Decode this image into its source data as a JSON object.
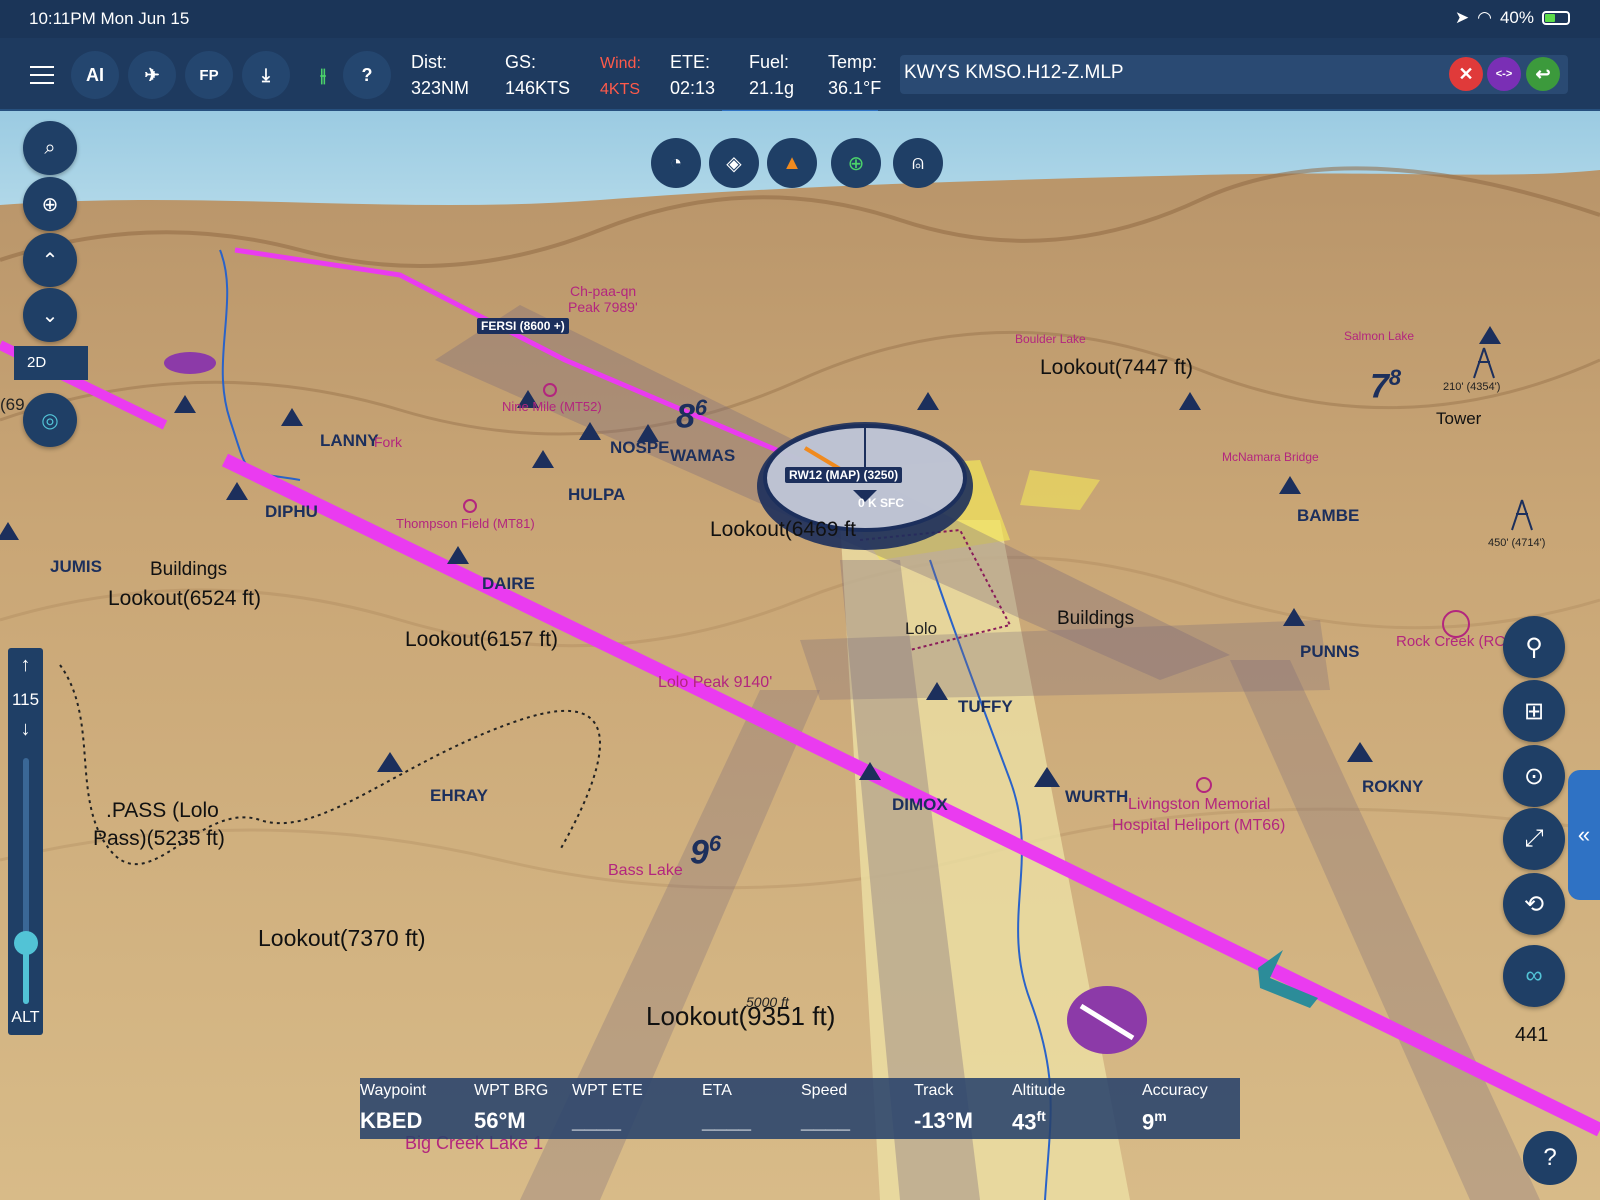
{
  "status": {
    "time": "10:11PM  Mon Jun 15",
    "battery": "40%",
    "battery_fill": 0.4
  },
  "toolbar": {
    "ai_label": "AI",
    "fp_label": "FP",
    "dist_label": "Dist:",
    "dist_value": "323NM",
    "gs_label": "GS:",
    "gs_value": "146KTS",
    "wind_label": "Wind:",
    "wind_value": "4KTS",
    "ete_label": "ETE:",
    "ete_value": "02:13",
    "fuel_label": "Fuel:",
    "fuel_value": "21.1g",
    "temp_label": "Temp:",
    "temp_value": "36.1°F",
    "route": "KWYS KMSO.H12-Z.MLP",
    "swap_label": "<->"
  },
  "map": {
    "mode_label": "2D",
    "alt_value": "115",
    "alt_label": "ALT",
    "alt_level": 0.25,
    "count": "441",
    "labels": {
      "lookout_7447": "Lookout(7447 ft)",
      "lookout_6469": "Lookout(6469 ft",
      "lookout_6524": "Lookout(6524 ft)",
      "lookout_6157": "Lookout(6157 ft)",
      "lookout_7370": "Lookout(7370 ft)",
      "lookout_9351": "Lookout(9351 ft)",
      "lolo_pass_1": ".PASS (Lolo",
      "lolo_pass_2": "Pass)(5235 ft)",
      "buildings1": "Buildings",
      "buildings2": "Buildings",
      "tower": "Tower",
      "lanny": "LANNY",
      "nospe": "NOSPE",
      "wamas": "WAMAS",
      "hulpa": "HULPA",
      "diphu": "DIPHU",
      "jumis": "JUMIS",
      "daire": "DAIRE",
      "ehray": "EHRAY",
      "tuffy": "TUFFY",
      "wurth": "WURTH",
      "dimox": "DIMOX",
      "rokny": "ROKNY",
      "punns": "PUNNS",
      "bambe": "BAMBE",
      "lolo": "Lolo",
      "fork": "Fork",
      "chpaa1": "Ch-paa-qn",
      "chpaa2": "Peak 7989'",
      "ninemile": "Nine Mile (MT52)",
      "thompson": "Thompson Field (MT81)",
      "lolopeak": "Lolo Peak 9140'",
      "basslake": "Bass Lake",
      "boulder": "Boulder Lake",
      "salmon": "Salmon Lake",
      "mcnamara": "McNamara Bridge",
      "rockcreek": "Rock Creek (RC",
      "livingston1": "Livingston Memorial",
      "livingston2": "Hospital Heliport (MT66)",
      "bigcreek": "Big Creek Lake 1",
      "fersi": "FERSI (8600 +)",
      "rw12": "RW12 (MAP) (3250)",
      "sfc": "0 K SFC",
      "t210": "210' (4354')",
      "t450": "450' (4714')",
      "mef_86": "8",
      "mef_86_sup": "6",
      "mef_78": "7",
      "mef_78_sup": "8",
      "mef_96": "9",
      "mef_96_sup": "6",
      "contour5000": "5000 ft",
      "left69": "(69"
    }
  },
  "infobar": {
    "cols": [
      {
        "h": "Waypoint",
        "v": "KBED",
        "sup": ""
      },
      {
        "h": "WPT BRG",
        "v": "56°M",
        "sup": ""
      },
      {
        "h": "WPT ETE",
        "v": "____",
        "sup": ""
      },
      {
        "h": "ETA",
        "v": "____",
        "sup": ""
      },
      {
        "h": "Speed",
        "v": "____",
        "sup": ""
      },
      {
        "h": "Track",
        "v": "-13°M",
        "sup": ""
      },
      {
        "h": "Altitude",
        "v": "43",
        "sup": "ft"
      },
      {
        "h": "Accuracy",
        "v": "9",
        "sup": "m"
      }
    ]
  }
}
